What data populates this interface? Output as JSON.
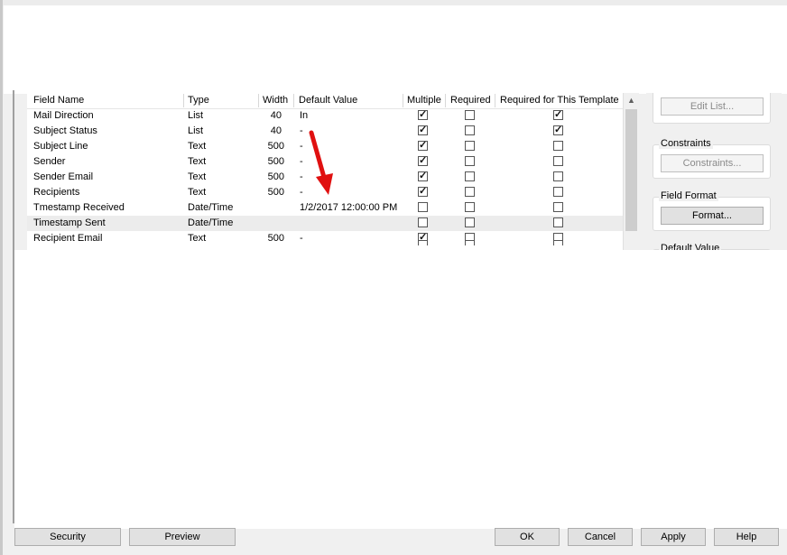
{
  "grid": {
    "columns": [
      "Field Name",
      "Type",
      "Width",
      "Default Value",
      "Multiple",
      "Required",
      "Required for This Template"
    ],
    "rows": [
      {
        "field": "Mail Direction",
        "type": "List",
        "width": "40",
        "default": "In",
        "multiple": true,
        "required": false,
        "template": true
      },
      {
        "field": "Subject Status",
        "type": "List",
        "width": "40",
        "default": "-",
        "multiple": true,
        "required": false,
        "template": true
      },
      {
        "field": "Subject Line",
        "type": "Text",
        "width": "500",
        "default": "-",
        "multiple": true,
        "required": false,
        "template": false
      },
      {
        "field": "Sender",
        "type": "Text",
        "width": "500",
        "default": "-",
        "multiple": true,
        "required": false,
        "template": false
      },
      {
        "field": "Sender Email",
        "type": "Text",
        "width": "500",
        "default": "-",
        "multiple": true,
        "required": false,
        "template": false
      },
      {
        "field": "Recipients",
        "type": "Text",
        "width": "500",
        "default": "-",
        "multiple": true,
        "required": false,
        "template": false
      },
      {
        "field": "Tmestamp Received",
        "type": "Date/Time",
        "width": "",
        "default": "1/2/2017 12:00:00 PM",
        "multiple": false,
        "required": false,
        "template": false
      },
      {
        "field": "Timestamp Sent",
        "type": "Date/Time",
        "width": "",
        "default": "",
        "multiple": false,
        "required": false,
        "template": false
      },
      {
        "field": "Recipient Email",
        "type": "Text",
        "width": "500",
        "default": "-",
        "multiple": true,
        "required": false,
        "template": false
      }
    ]
  },
  "right": {
    "edit_list": "Edit List...",
    "constraints_legend": "Constraints",
    "constraints_button": "Constraints...",
    "field_format_legend": "Field Format",
    "format_button": "Format...",
    "default_value_legend": "Default Value"
  },
  "bottom": {
    "security": "Security",
    "preview": "Preview",
    "ok": "OK",
    "cancel": "Cancel",
    "apply": "Apply",
    "help": "Help"
  },
  "colors": {
    "annotation_arrow": "#e01010"
  }
}
